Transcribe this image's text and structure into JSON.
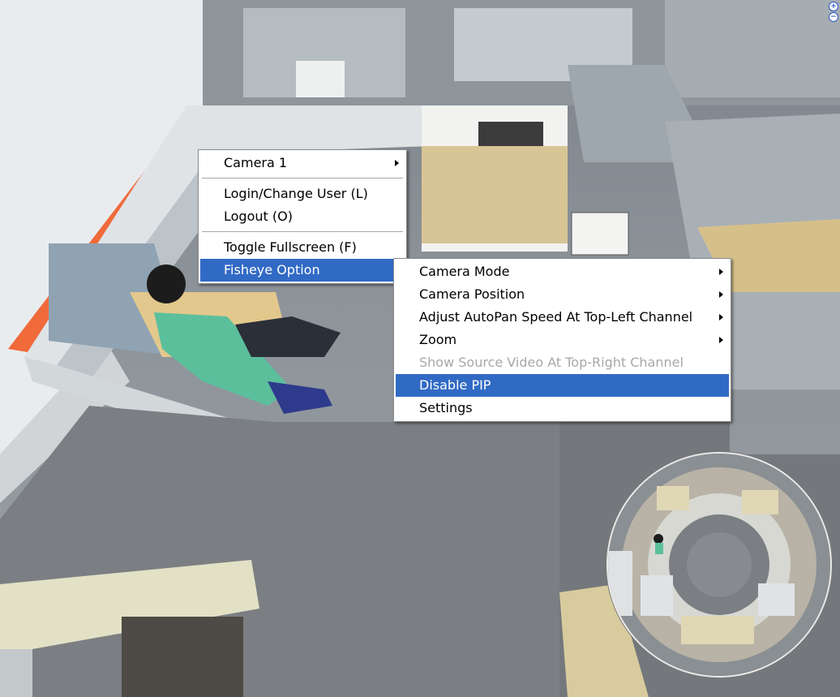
{
  "zoom_controls": {
    "zoom_in_symbol": "+",
    "zoom_out_symbol": "−"
  },
  "context_menu": {
    "items": [
      {
        "label": "Camera 1",
        "has_submenu": true
      },
      {
        "label": "Login/Change User (L)"
      },
      {
        "label": "Logout (O)"
      },
      {
        "label": "Toggle Fullscreen (F)"
      },
      {
        "label": "Fisheye Option",
        "has_submenu": true,
        "selected": true
      }
    ]
  },
  "fisheye_submenu": {
    "items": [
      {
        "label": "Camera Mode",
        "has_submenu": true
      },
      {
        "label": "Camera Position",
        "has_submenu": true
      },
      {
        "label": "Adjust AutoPan Speed At Top-Left Channel",
        "has_submenu": true
      },
      {
        "label": "Zoom",
        "has_submenu": true
      },
      {
        "label": "Show Source Video At Top-Right Channel",
        "disabled": true
      },
      {
        "label": "Disable PIP",
        "selected": true
      },
      {
        "label": "Settings"
      }
    ]
  },
  "colors": {
    "menu_highlight": "#316ac5",
    "disabled_text": "#a8a8a8",
    "zoom_icon": "#2a56c6"
  }
}
